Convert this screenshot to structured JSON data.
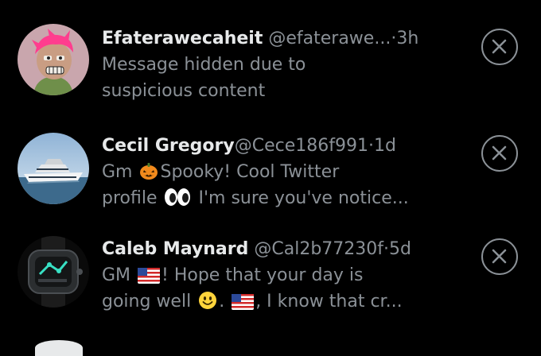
{
  "notifications": [
    {
      "display_name": "Efaterawecaheit",
      "handle": "@efaterawe...",
      "separator": "·",
      "time": "3h",
      "line1": "Message hidden due to",
      "line2": "suspicious content",
      "avatar_icon": "pink-haired-ape-avatar-icon",
      "dismiss_icon": "close-circle-icon"
    },
    {
      "display_name": "Cecil Gregory",
      "handle": "@Cece186f991",
      "separator": "·",
      "time": "1d",
      "line1_pre": "Gm ",
      "line1_post": "Spooky! Cool Twitter",
      "line2_pre": "profile ",
      "line2_post": " I'm sure you've notice...",
      "avatar_icon": "yacht-photo-avatar-icon",
      "dismiss_icon": "close-circle-icon"
    },
    {
      "display_name": "Caleb Maynard",
      "handle": "@Cal2b77230f",
      "separator": "·",
      "time": "5d",
      "line1_pre": "GM ",
      "line1_post": "! Hope that your day is",
      "line2_pre": "going well ",
      "line2_mid": ". ",
      "line2_post": ", I know that cr...",
      "avatar_icon": "luxury-watch-avatar-icon",
      "dismiss_icon": "close-circle-icon"
    }
  ],
  "colors": {
    "background": "#000000",
    "primary_text": "#e7e9ea",
    "secondary_text": "#8b9197"
  }
}
